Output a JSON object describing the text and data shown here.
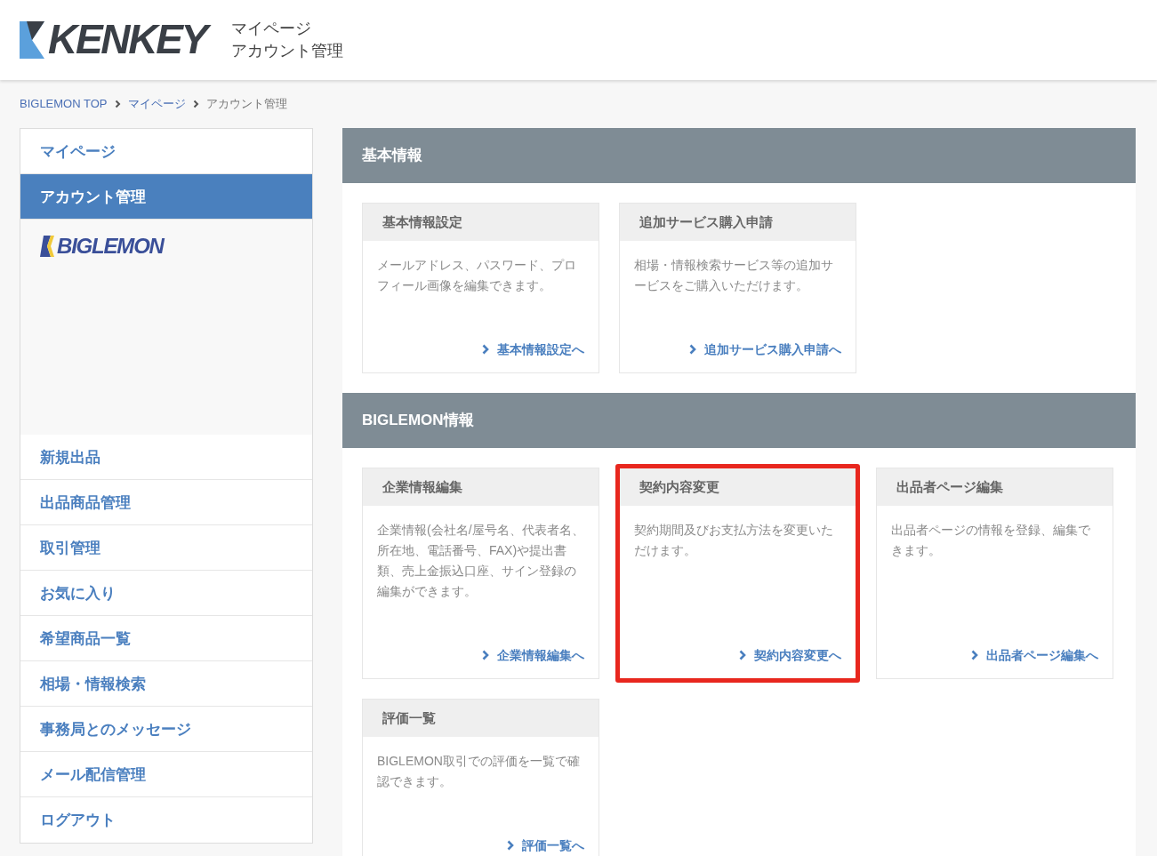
{
  "header": {
    "logo": "KENKEY",
    "subtitle_lines": [
      "マイページ",
      "アカウント管理"
    ]
  },
  "breadcrumb": [
    {
      "label": "BIGLEMON TOP",
      "current": false
    },
    {
      "label": "マイページ",
      "current": false
    },
    {
      "label": "アカウント管理",
      "current": true
    }
  ],
  "sidebar": {
    "items": [
      {
        "label": "マイページ",
        "selected": false
      },
      {
        "label": "アカウント管理",
        "selected": true
      }
    ],
    "brand_logo": "BIGLEMON",
    "links": [
      "新規出品",
      "出品商品管理",
      "取引管理",
      "お気に入り",
      "希望商品一覧",
      "相場・情報検索",
      "事務局とのメッセージ",
      "メール配信管理",
      "ログアウト"
    ]
  },
  "sections": [
    {
      "title": "基本情報",
      "cards": [
        {
          "title": "基本情報設定",
          "description": "メールアドレス、パスワード、プロフィール画像を編集できます。",
          "link": "基本情報設定へ",
          "highlighted": false
        },
        {
          "title": "追加サービス購入申請",
          "description": "相場・情報検索サービス等の追加サービスをご購入いただけます。",
          "link": "追加サービス購入申請へ",
          "highlighted": false
        }
      ]
    },
    {
      "title": "BIGLEMON情報",
      "cards": [
        {
          "title": "企業情報編集",
          "description": "企業情報(会社名/屋号名、代表者名、所在地、電話番号、FAX)や提出書類、売上金振込口座、サイン登録の編集ができます。",
          "link": "企業情報編集へ",
          "highlighted": false
        },
        {
          "title": "契約内容変更",
          "description": "契約期間及びお支払方法を変更いただけます。",
          "link": "契約内容変更へ",
          "highlighted": true
        },
        {
          "title": "出品者ページ編集",
          "description": "出品者ページの情報を登録、編集できます。",
          "link": "出品者ページ編集へ",
          "highlighted": false
        },
        {
          "title": "評価一覧",
          "description": "BIGLEMON取引での評価を一覧で確認できます。",
          "link": "評価一覧へ",
          "highlighted": false
        }
      ]
    }
  ]
}
